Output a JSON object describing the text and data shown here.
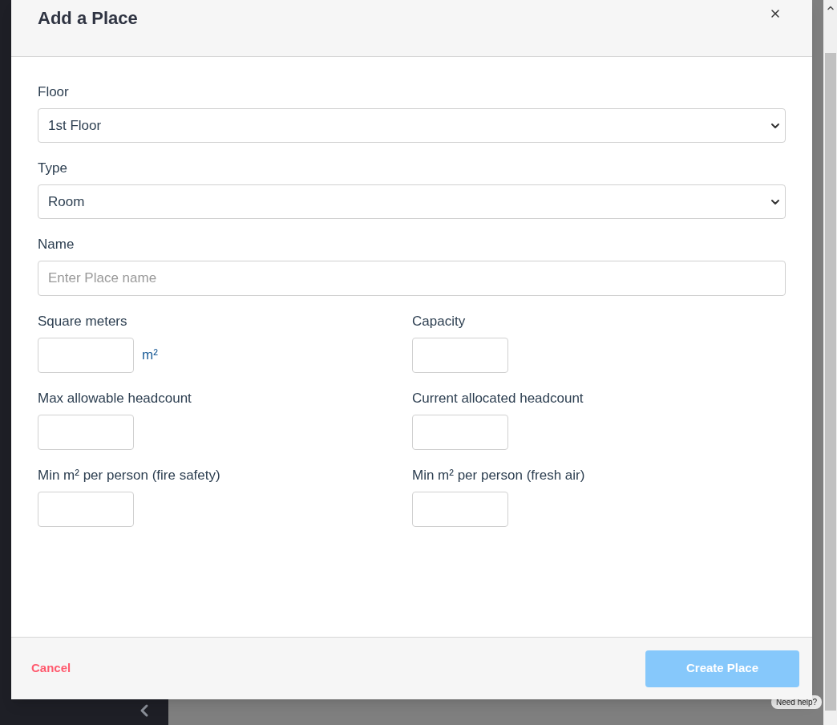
{
  "dialog": {
    "title": "Add a Place"
  },
  "fields": [
    {
      "kind": "select",
      "label": "Floor",
      "value": "1st Floor"
    },
    {
      "kind": "select",
      "label": "Type",
      "value": "Room"
    },
    {
      "kind": "text",
      "label": "Name",
      "placeholder": "Enter Place name"
    }
  ],
  "measures": [
    {
      "label": "Square meters",
      "unit": "m²"
    },
    {
      "label": "Capacity"
    },
    {
      "label": "Max allowable headcount"
    },
    {
      "label": "Current allocated headcount"
    },
    {
      "label": "Min m² per person (fire safety)"
    },
    {
      "label": "Min m² per person (fresh air)"
    }
  ],
  "footer": {
    "cancel": "Cancel",
    "submit": {
      "label": "Create Place",
      "disabled": true
    }
  },
  "help_widget": {
    "label": "Need help?"
  }
}
